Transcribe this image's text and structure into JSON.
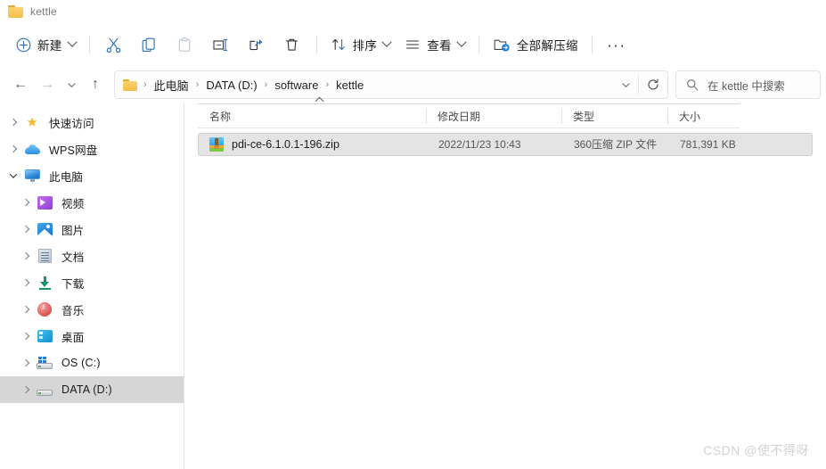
{
  "window": {
    "title": "kettle",
    "folder_icon": "folder-icon"
  },
  "toolbar": {
    "new_label": "新建",
    "new_icon": "plus-circle-icon",
    "cut_icon": "scissors-icon",
    "copy_icon": "copy-icon",
    "paste_icon": "paste-icon",
    "rename_icon": "rename-icon",
    "share_icon": "share-icon",
    "delete_icon": "trash-icon",
    "sort_label": "排序",
    "sort_icon": "sort-arrows-icon",
    "view_label": "查看",
    "view_icon": "list-lines-icon",
    "extract_label": "全部解压缩",
    "extract_icon": "extract-folder-icon",
    "more_label": "···",
    "more_icon": "ellipsis-icon"
  },
  "address": {
    "back_icon": "arrow-left-icon",
    "forward_icon": "arrow-right-icon",
    "recent_icon": "chevron-down-icon",
    "up_icon": "arrow-up-icon",
    "folder_icon": "folder-icon",
    "separator": "›",
    "breadcrumbs": [
      {
        "label": "此电脑"
      },
      {
        "label": "DATA (D:)"
      },
      {
        "label": "software"
      },
      {
        "label": "kettle"
      }
    ],
    "dropdown_icon": "chevron-down-icon",
    "refresh_icon": "refresh-icon"
  },
  "search": {
    "icon": "search-icon",
    "placeholder": "在 kettle 中搜索"
  },
  "sidebar": {
    "items": [
      {
        "label": "快速访问",
        "icon": "star-icon",
        "expanded": false,
        "indent": false,
        "selected": false
      },
      {
        "label": "WPS网盘",
        "icon": "cloud-icon",
        "expanded": false,
        "indent": false,
        "selected": false
      },
      {
        "label": "此电脑",
        "icon": "monitor-icon",
        "expanded": true,
        "indent": false,
        "selected": false
      },
      {
        "label": "视频",
        "icon": "video-icon",
        "expanded": false,
        "indent": true,
        "selected": false
      },
      {
        "label": "图片",
        "icon": "picture-icon",
        "expanded": false,
        "indent": true,
        "selected": false
      },
      {
        "label": "文档",
        "icon": "document-icon",
        "expanded": false,
        "indent": true,
        "selected": false
      },
      {
        "label": "下载",
        "icon": "download-icon",
        "expanded": false,
        "indent": true,
        "selected": false
      },
      {
        "label": "音乐",
        "icon": "music-icon",
        "expanded": false,
        "indent": true,
        "selected": false
      },
      {
        "label": "桌面",
        "icon": "desktop-icon",
        "expanded": false,
        "indent": true,
        "selected": false
      },
      {
        "label": "OS (C:)",
        "icon": "drive-windows-icon",
        "expanded": false,
        "indent": true,
        "selected": false
      },
      {
        "label": "DATA (D:)",
        "icon": "drive-icon",
        "expanded": false,
        "indent": true,
        "selected": true
      }
    ]
  },
  "filelist": {
    "columns": [
      {
        "key": "name",
        "label": "名称",
        "sorted": "asc"
      },
      {
        "key": "date",
        "label": "修改日期",
        "sorted": ""
      },
      {
        "key": "type",
        "label": "类型",
        "sorted": ""
      },
      {
        "key": "size",
        "label": "大小",
        "sorted": ""
      }
    ],
    "rows": [
      {
        "name": "pdi-ce-6.1.0.1-196.zip",
        "date": "2022/11/23 10:43",
        "type": "360压缩 ZIP 文件",
        "size": "781,391 KB",
        "icon": "zip-archive-icon",
        "selected": true
      }
    ]
  },
  "watermark": {
    "text": "CSDN @使不得呀"
  },
  "colors": {
    "accent": "#0078d4",
    "folder_yellow": "#f4c049",
    "selection_bg": "#e4e4e4",
    "sidebar_selection_bg": "#d6d6d6",
    "text_primary": "#1b1b1b",
    "text_secondary": "#555555"
  }
}
